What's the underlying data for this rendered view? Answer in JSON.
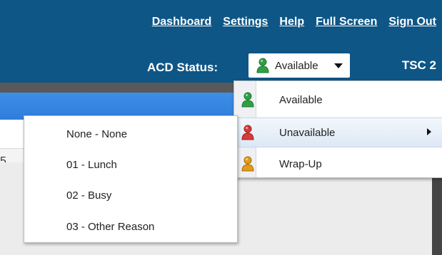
{
  "nav": {
    "links": [
      "Dashboard",
      "Settings",
      "Help",
      "Full Screen",
      "Sign Out"
    ]
  },
  "acd": {
    "label": "ACD Status:",
    "selected": "Available",
    "selected_icon": "user-green-icon",
    "tsc_label": "TSC 2"
  },
  "status_menu": {
    "items": [
      {
        "label": "Available",
        "icon": "user-green-icon",
        "color": "#2ea043"
      },
      {
        "label": "Unavailable",
        "icon": "user-red-icon",
        "color": "#d63a3a",
        "has_submenu": true
      },
      {
        "label": "Wrap-Up",
        "icon": "user-orange-icon",
        "color": "#e59a18"
      }
    ]
  },
  "reason_menu": {
    "items": [
      "None - None",
      "01 - Lunch",
      "02 - Busy",
      "03 - Other Reason"
    ]
  },
  "background": {
    "edge_char": "5"
  },
  "colors": {
    "header_bg": "#0e5686",
    "band_blue": "#3d8fe6",
    "available": "#2ea043",
    "unavailable": "#d63a3a",
    "wrapup": "#e59a18"
  }
}
